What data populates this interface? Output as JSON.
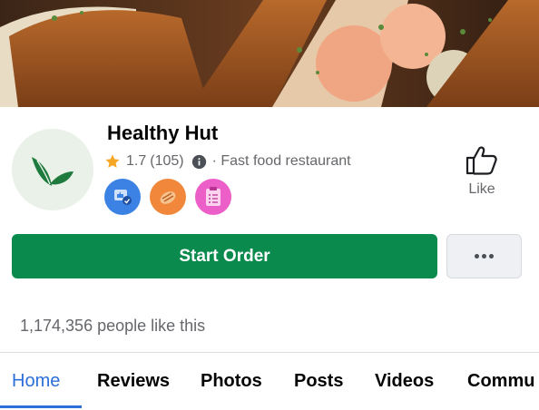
{
  "page": {
    "name": "Healthy Hut",
    "rating": "1.7",
    "review_count": "(105)",
    "category": "· Fast food restaurant",
    "likes": "1,174,356 people like this"
  },
  "actions": {
    "like_label": "Like",
    "start_order_label": "Start Order"
  },
  "badges": [
    {
      "name": "top-fan-badge",
      "icon": "thumbs-up-user-icon",
      "color": "#3b82e4"
    },
    {
      "name": "food-badge",
      "icon": "bread-icon",
      "color": "#f0873a"
    },
    {
      "name": "checklist-badge",
      "icon": "clipboard-icon",
      "color": "#ec5fc8"
    }
  ],
  "tabs": [
    {
      "label": "Home",
      "active": true
    },
    {
      "label": "Reviews"
    },
    {
      "label": "Photos"
    },
    {
      "label": "Posts"
    },
    {
      "label": "Videos"
    },
    {
      "label": "Commu"
    }
  ],
  "colors": {
    "brand_green": "#0b8a4d",
    "tab_active": "#2d6fd9",
    "star": "#f5a623"
  }
}
